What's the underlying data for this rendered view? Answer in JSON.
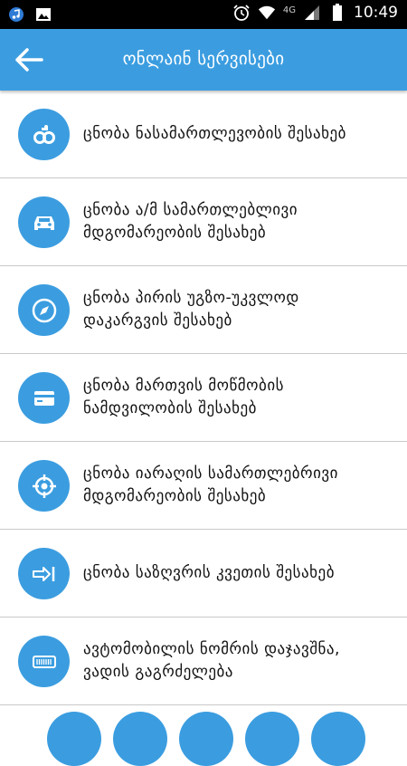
{
  "status_bar": {
    "time": "10:49",
    "network": "4G",
    "icons": [
      "music-icon",
      "image-icon",
      "alarm-icon",
      "wifi-icon",
      "signal-icon",
      "battery-icon"
    ]
  },
  "app_bar": {
    "title": "ონლაინ სერვისები",
    "back_icon": "arrow-left-icon"
  },
  "services": [
    {
      "label": "ცნობა ნასამართლევობის შესახებ",
      "icon": "handcuffs-icon"
    },
    {
      "label": "ცნობა ა/მ სამართლებლივი მდგომარეობის შესახებ",
      "icon": "car-icon"
    },
    {
      "label": "ცნობა პირის უგზო-უკვლოდ დაკარგვის შესახებ",
      "icon": "compass-icon"
    },
    {
      "label": "ცნობა მართვის მოწმობის ნამდვილობის შესახებ",
      "icon": "card-icon"
    },
    {
      "label": "ცნობა იარაღის სამართლებრივი მდგომარეობის შესახებ",
      "icon": "crosshair-icon"
    },
    {
      "label": "ცნობა საზღვრის კვეთის შესახებ",
      "icon": "border-crossing-icon"
    },
    {
      "label": "ავტომობილის ნომრის დაჯავშნა, ვადის გაგრძელება",
      "icon": "license-plate-icon"
    }
  ],
  "colors": {
    "accent": "#3b9de0",
    "statusbar": "#000000",
    "divider": "#c9c9c9"
  }
}
